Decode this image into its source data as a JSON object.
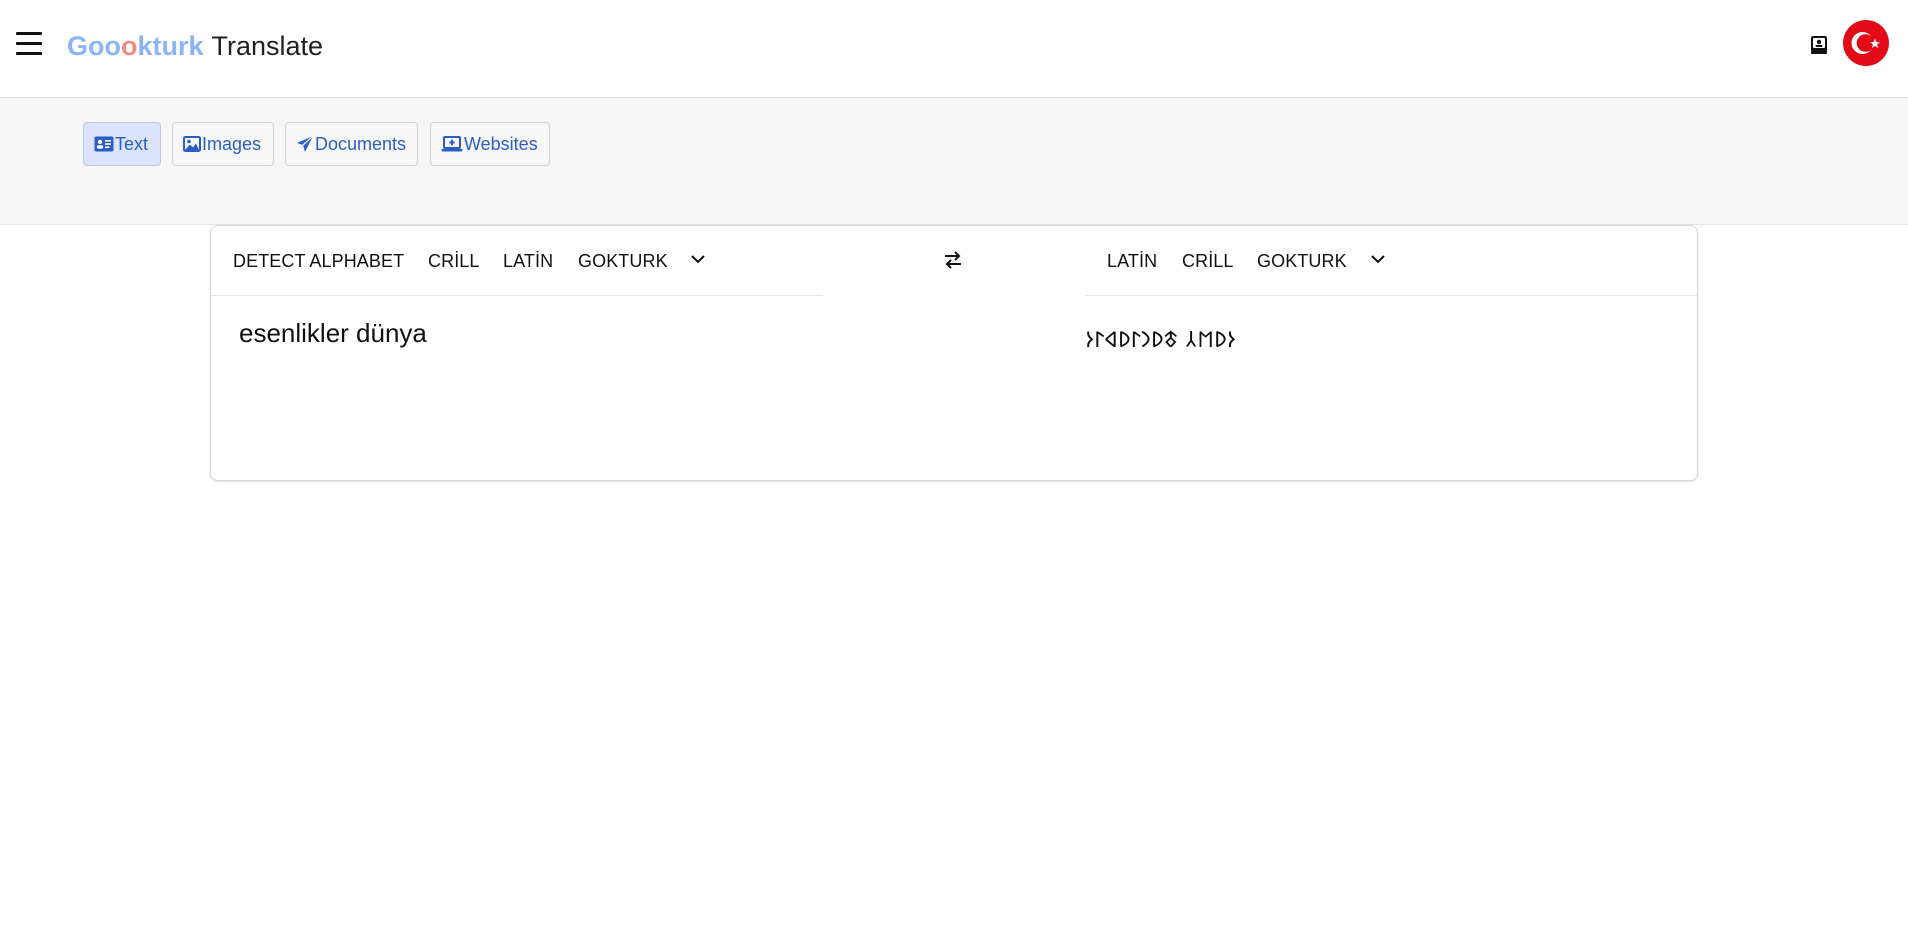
{
  "header": {
    "logo": {
      "part1": "Goo",
      "part2": "o",
      "part3": "kturk",
      "part4": "Translate"
    },
    "icons": {
      "menu": "hamburger-menu-icon",
      "book": "book-icon",
      "flag": "turkey-flag-icon"
    }
  },
  "modes": [
    {
      "label": "Text",
      "icon": "id-card-icon",
      "active": true
    },
    {
      "label": "Images",
      "icon": "image-icon",
      "active": false
    },
    {
      "label": "Documents",
      "icon": "paper-plane-icon",
      "active": false
    },
    {
      "label": "Websites",
      "icon": "laptop-plus-icon",
      "active": false
    }
  ],
  "source": {
    "languages": [
      "DETECT ALPHABET",
      "CRİLL",
      "LATİN",
      "GOKTURK"
    ],
    "text": "esenlikler dünya"
  },
  "target": {
    "languages": [
      "LATİN",
      "CRİLL",
      "GOKTURK"
    ],
    "text": "𐰆𐰖𐰡𐰲 𐱃𐰖𐰣𐰃𐰖𐰶𐰃𐰆"
  },
  "colors": {
    "brand_blue": "#8ab4f8",
    "brand_red": "#f28b82",
    "link_blue": "#2a5ec4",
    "active_bg": "#dbe2fa"
  }
}
